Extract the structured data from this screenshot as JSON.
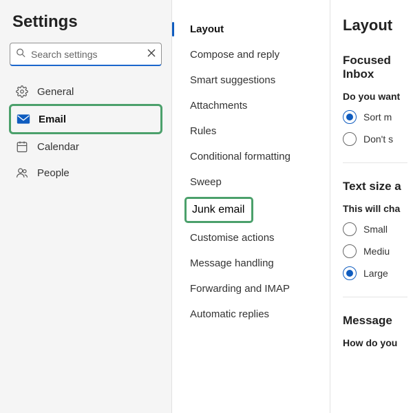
{
  "page_title": "Settings",
  "search": {
    "placeholder": "Search settings"
  },
  "nav": {
    "general": "General",
    "email": "Email",
    "calendar": "Calendar",
    "people": "People"
  },
  "submenu": {
    "items": [
      "Layout",
      "Compose and reply",
      "Smart suggestions",
      "Attachments",
      "Rules",
      "Conditional formatting",
      "Sweep",
      "Junk email",
      "Customise actions",
      "Message handling",
      "Forwarding and IMAP",
      "Automatic replies"
    ]
  },
  "content": {
    "title": "Layout",
    "focused": {
      "heading": "Focused Inbox",
      "question": "Do you want",
      "opt1": "Sort m",
      "opt2": "Don't s"
    },
    "textsize": {
      "heading": "Text size a",
      "question": "This will cha",
      "opt1": "Small",
      "opt2": "Mediu",
      "opt3": "Large"
    },
    "message": {
      "heading": "Message",
      "question": "How do you"
    }
  }
}
